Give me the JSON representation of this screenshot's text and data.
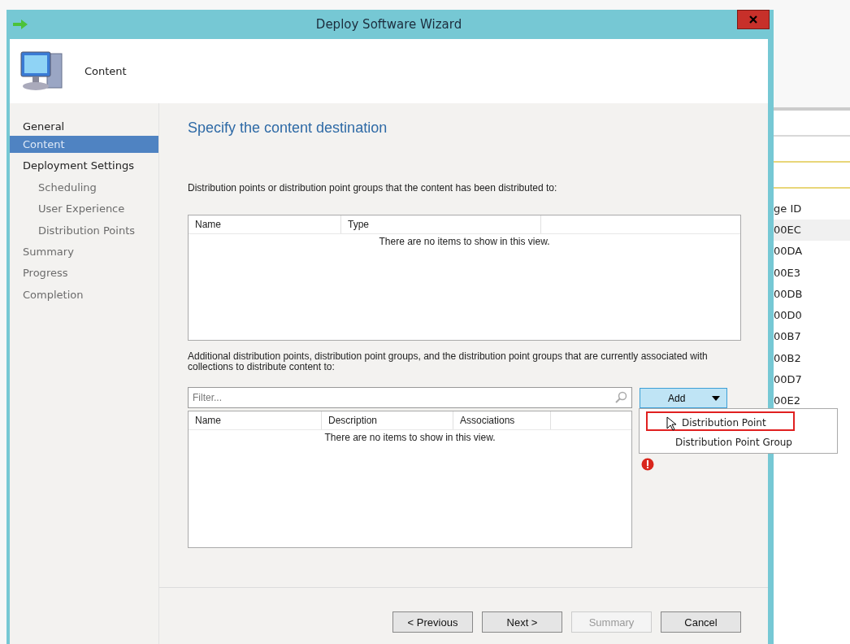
{
  "window": {
    "title": "Deploy Software Wizard"
  },
  "header": {
    "title": "Content"
  },
  "sidebar": {
    "items": [
      {
        "label": "General",
        "selected": false,
        "disabled": false
      },
      {
        "label": "Content",
        "selected": true,
        "disabled": false
      },
      {
        "label": "Deployment Settings",
        "selected": false,
        "disabled": false,
        "children": [
          {
            "label": "Scheduling",
            "selected": false,
            "disabled": true
          },
          {
            "label": "User Experience",
            "selected": false,
            "disabled": true
          },
          {
            "label": "Distribution Points",
            "selected": false,
            "disabled": true
          }
        ]
      },
      {
        "label": "Summary",
        "selected": false,
        "disabled": true
      },
      {
        "label": "Progress",
        "selected": false,
        "disabled": true
      },
      {
        "label": "Completion",
        "selected": false,
        "disabled": true
      }
    ]
  },
  "page": {
    "heading": "Specify the content destination",
    "distributed_label": "Distribution points or distribution point groups that the content has been distributed to:",
    "distributed_table": {
      "columns": [
        "Name",
        "Type"
      ],
      "empty_text": "There are no items to show in this view."
    },
    "additional_label": "Additional distribution points, distribution point groups, and the distribution point groups that are currently associated with collections to distribute content to:",
    "filter": {
      "placeholder": "Filter..."
    },
    "additional_table": {
      "columns": [
        "Name",
        "Description",
        "Associations"
      ],
      "empty_text": "There are no items to show in this view."
    },
    "add_button": "Add",
    "add_menu": [
      {
        "label": "Distribution Point",
        "highlighted": true
      },
      {
        "label": "Distribution Point Group",
        "highlighted": false
      }
    ],
    "error": true
  },
  "buttons": [
    {
      "label": "< Previous",
      "disabled": false
    },
    {
      "label": "Next >",
      "disabled": false
    },
    {
      "label": "Summary",
      "disabled": true
    },
    {
      "label": "Cancel",
      "disabled": false
    }
  ],
  "background_window": {
    "column": "ge ID",
    "rows": [
      "00EC",
      "00DA",
      "00E3",
      "00DB",
      "00D0",
      "00B7",
      "00B2",
      "00D7",
      "00E2"
    ]
  }
}
